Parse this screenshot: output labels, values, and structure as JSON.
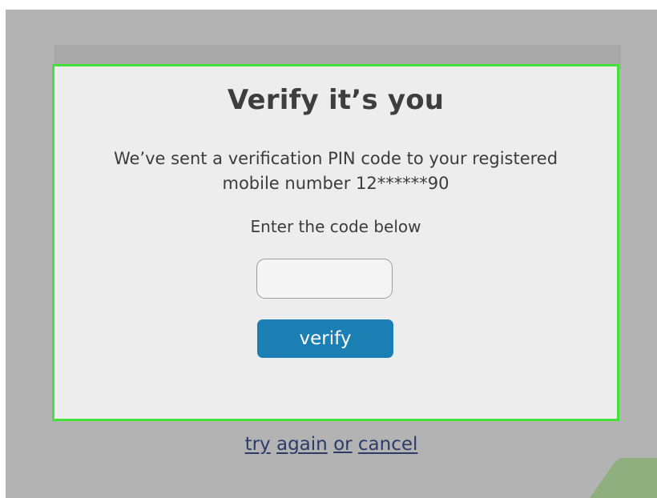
{
  "dialog": {
    "title": "Verify it’s you",
    "message_line1": "We’ve sent a verification PIN code to your registered",
    "message_line2": "mobile number 12******90",
    "instruction": "Enter the code below",
    "pin_input": {
      "value": "",
      "placeholder": ""
    },
    "verify_label": "verify"
  },
  "footer": {
    "try": "try",
    "again": "again",
    "or": "or",
    "cancel": "cancel"
  },
  "colors": {
    "backdrop": "#b3b3b3",
    "dialog_bg": "#ededed",
    "dialog_border": "#43e13a",
    "button": "#1b7fb4",
    "link": "#2c3b6a"
  }
}
